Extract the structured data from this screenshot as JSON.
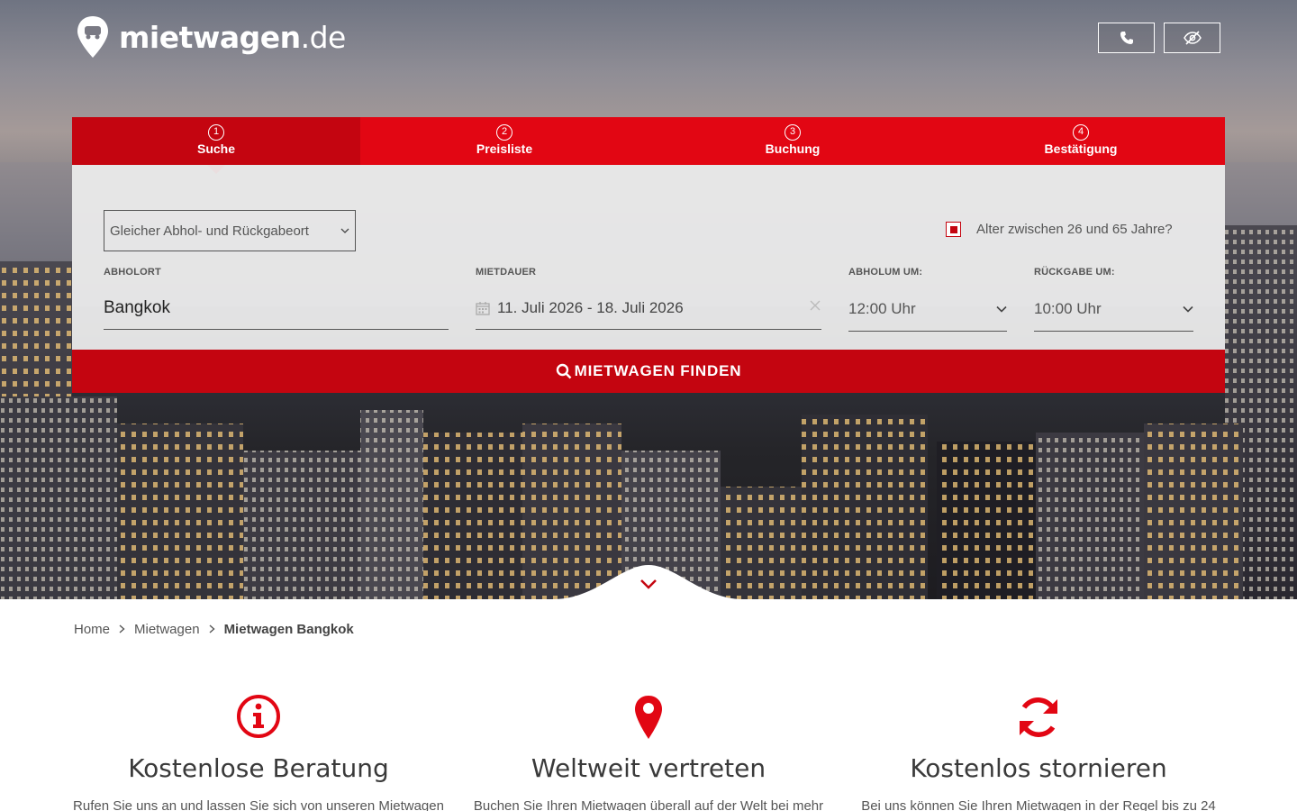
{
  "header": {
    "logo_main": "mietwagen",
    "logo_tld": ".de",
    "phone_icon": "phone-icon",
    "privacy_icon": "eye-slash-icon"
  },
  "steps": [
    {
      "num": "1",
      "label": "Suche",
      "active": true
    },
    {
      "num": "2",
      "label": "Preisliste"
    },
    {
      "num": "3",
      "label": "Buchung"
    },
    {
      "num": "4",
      "label": "Bestätigung"
    }
  ],
  "search": {
    "return_option": "Gleicher Abhol- und Rückgabeort",
    "age_label": "Alter zwischen 26 und 65 Jahre?",
    "age_checked": true,
    "pickup_label": "ABHOLORT",
    "pickup_value": "Bangkok",
    "duration_label": "MIETDAUER",
    "duration_value": "11. Juli 2026 - 18. Juli 2026",
    "pickup_time_label": "ABHOLUM UM:",
    "pickup_time_value": "12:00 Uhr",
    "return_time_label": "RÜCKGABE UM:",
    "return_time_value": "10:00 Uhr",
    "submit_label": "MIETWAGEN FINDEN"
  },
  "breadcrumb": {
    "items": [
      "Home",
      "Mietwagen"
    ],
    "current": "Mietwagen Bangkok"
  },
  "features": [
    {
      "icon": "info-circle-icon",
      "title": "Kostenlose Beratung",
      "text": "Rufen Sie uns an und lassen Sie sich von unseren Mietwagen"
    },
    {
      "icon": "map-marker-icon",
      "title": "Weltweit vertreten",
      "text": "Buchen Sie Ihren Mietwagen überall auf der Welt bei mehr"
    },
    {
      "icon": "refresh-icon",
      "title": "Kostenlos stornieren",
      "text": "Bei uns können Sie Ihren Mietwagen in der Regel bis zu 24"
    }
  ],
  "colors": {
    "brand_red": "#e20613",
    "dark_red": "#c40510"
  }
}
